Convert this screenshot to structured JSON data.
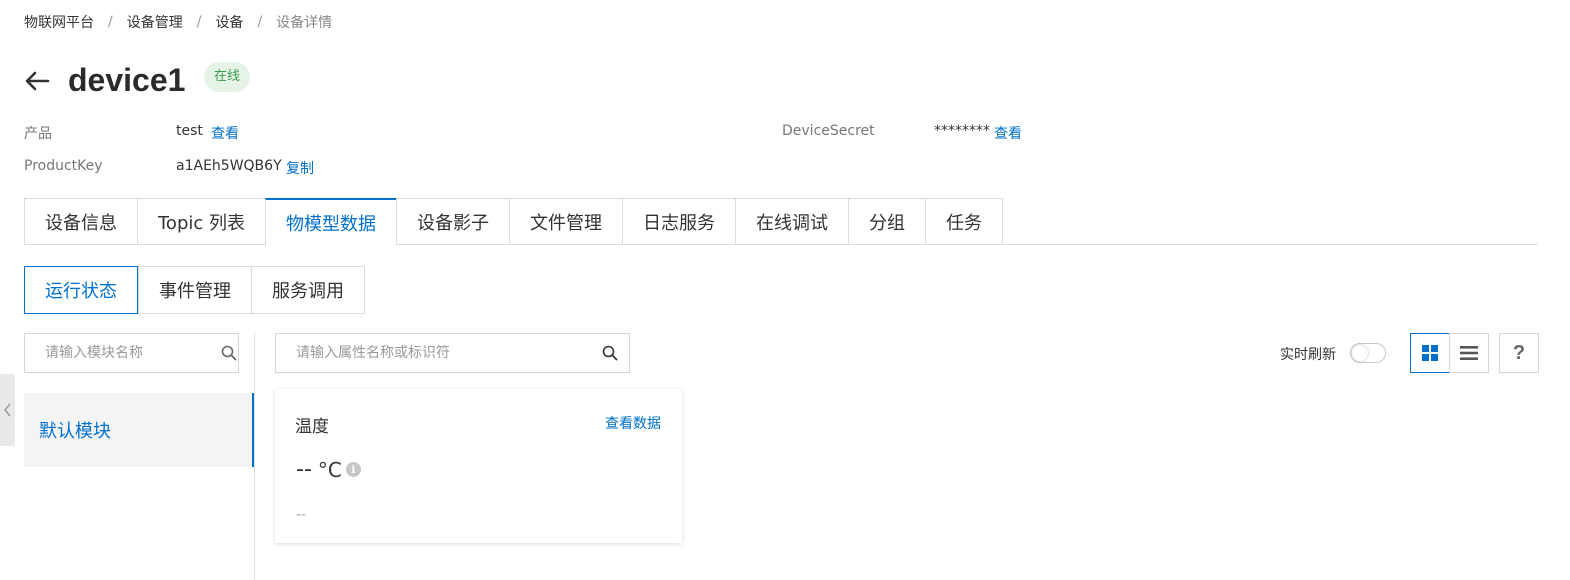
{
  "breadcrumb": [
    "物联网平台",
    "设备管理",
    "设备",
    "设备详情"
  ],
  "breadcrumb_sep": "/",
  "device": {
    "name": "device1",
    "status": "在线"
  },
  "info": {
    "product_label": "产品",
    "product_value": "test",
    "product_link": "查看",
    "productkey_label": "ProductKey",
    "productkey_value": "a1AEh5WQB6Y",
    "productkey_link": "复制",
    "secret_label": "DeviceSecret",
    "secret_value": "********",
    "secret_link": "查看"
  },
  "tabs": [
    "设备信息",
    "Topic 列表",
    "物模型数据",
    "设备影子",
    "文件管理",
    "日志服务",
    "在线调试",
    "分组",
    "任务"
  ],
  "active_tab": "物模型数据",
  "subtabs": [
    "运行状态",
    "事件管理",
    "服务调用"
  ],
  "active_subtab": "运行状态",
  "module_search": {
    "placeholder": "请输入模块名称"
  },
  "property_search": {
    "placeholder": "请输入属性名称或标识符"
  },
  "modules": [
    "默认模块"
  ],
  "realtime_refresh": {
    "label": "实时刷新",
    "enabled": false
  },
  "help": "?",
  "card": {
    "title": "温度",
    "link": "查看数据",
    "value": "--",
    "unit": "°C",
    "time": "--"
  },
  "colors": {
    "accent": "#0070cc",
    "online_bg": "#e6f4e8",
    "online_text": "#3b9b4a"
  }
}
